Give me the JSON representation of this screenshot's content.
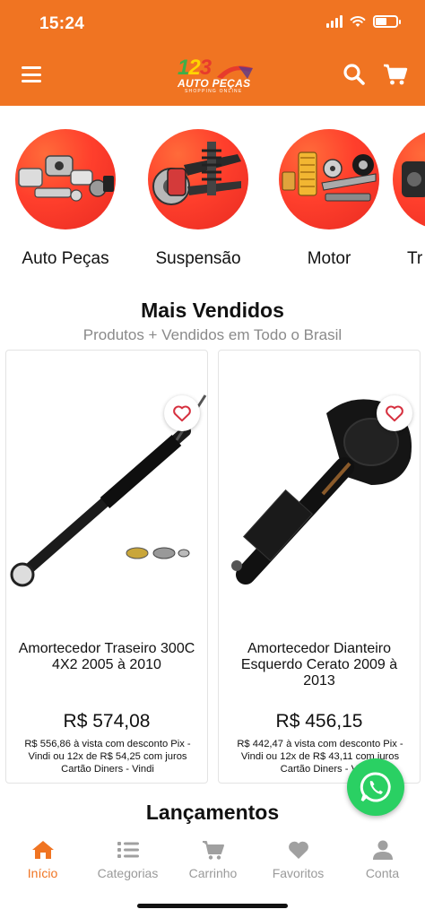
{
  "status_bar": {
    "time": "15:24"
  },
  "header": {
    "logo_number": [
      "1",
      "2",
      "3"
    ],
    "logo_name": "AUTO PEÇAS",
    "logo_tagline": "SHOPPING ONLINE"
  },
  "categories": [
    {
      "label": "Auto Peças",
      "icon": "auto-parts"
    },
    {
      "label": "Suspensão",
      "icon": "suspension"
    },
    {
      "label": "Motor",
      "icon": "engine"
    },
    {
      "label": "Tr",
      "icon": "transmission"
    }
  ],
  "best_sellers": {
    "title": "Mais Vendidos",
    "subtitle": "Produtos + Vendidos em Todo o Brasil",
    "products": [
      {
        "name": "Amortecedor Traseiro 300C 4X2 2005 à 2010",
        "price": "R$ 574,08",
        "payment": "R$ 556,86 à vista com desconto Pix - Vindi ou 12x de R$ 54,25 com juros Cartão Diners - Vindi"
      },
      {
        "name": "Amortecedor Dianteiro Esquerdo Cerato 2009 à 2013",
        "price": "R$ 456,15",
        "payment": "R$ 442,47 à vista com desconto Pix - Vindi ou 12x de R$ 43,11 com juros Cartão Diners - Vi"
      }
    ]
  },
  "launches": {
    "title": "Lançamentos"
  },
  "tabbar": [
    {
      "label": "Início",
      "icon": "home-icon",
      "active": true
    },
    {
      "label": "Categorias",
      "icon": "list-icon",
      "active": false
    },
    {
      "label": "Carrinho",
      "icon": "cart-icon",
      "active": false
    },
    {
      "label": "Favoritos",
      "icon": "heart-icon",
      "active": false
    },
    {
      "label": "Conta",
      "icon": "user-icon",
      "active": false
    }
  ],
  "colors": {
    "brand": "#f07422",
    "whatsapp": "#2ad063",
    "category_bg": "#ff3f2c"
  }
}
